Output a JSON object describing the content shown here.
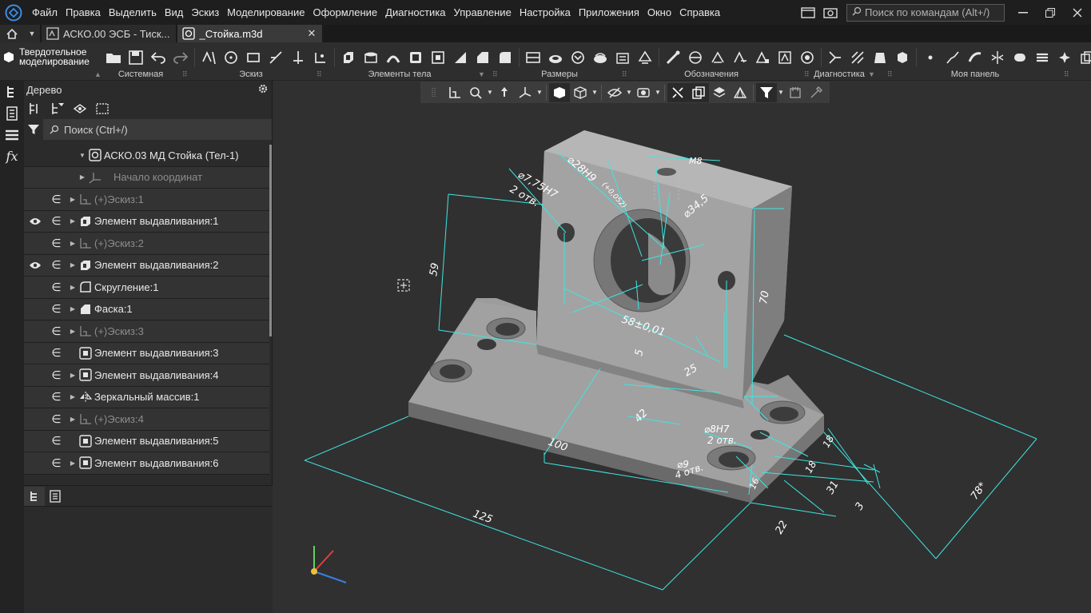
{
  "menu": {
    "items": [
      "Файл",
      "Правка",
      "Выделить",
      "Вид",
      "Эскиз",
      "Моделирование",
      "Оформление",
      "Диагностика",
      "Управление",
      "Настройка",
      "Приложения",
      "Окно",
      "Справка"
    ],
    "command_search_placeholder": "Поиск по командам (Alt+/)"
  },
  "tabs": {
    "items": [
      {
        "label": "АСКО.00 ЭСБ - Тиск..."
      },
      {
        "label": "_Стойка.m3d"
      }
    ],
    "close_glyph": "✕"
  },
  "toolbar": {
    "mode_line1": "Твердотельное",
    "mode_line2": "моделирование",
    "groups": [
      "Системная",
      "Эскиз",
      "Элементы тела",
      "Размеры",
      "Обозначения",
      "Диагностика",
      "Моя панель"
    ]
  },
  "tree": {
    "title": "Дерево",
    "search_placeholder": "Поиск (Ctrl+/)",
    "rows": [
      {
        "label": "АСКО.03 МД Стойка (Тел-1)",
        "icon": "part-icon",
        "dim": false
      },
      {
        "label": "Начало координат",
        "icon": "origin-icon",
        "dim": true
      },
      {
        "label": "(+)Эскиз:1",
        "icon": "sketch-icon",
        "dim": true
      },
      {
        "label": "Элемент выдавливания:1",
        "icon": "extrude-icon",
        "dim": false
      },
      {
        "label": "(+)Эскиз:2",
        "icon": "sketch-icon",
        "dim": true
      },
      {
        "label": "Элемент выдавливания:2",
        "icon": "extrude-icon",
        "dim": false
      },
      {
        "label": "Скругление:1",
        "icon": "fillet-icon",
        "dim": false
      },
      {
        "label": "Фаска:1",
        "icon": "chamfer-icon",
        "dim": false
      },
      {
        "label": "(+)Эскиз:3",
        "icon": "sketch-icon",
        "dim": true
      },
      {
        "label": "Элемент выдавливания:3",
        "icon": "cut-extrude-icon",
        "dim": false
      },
      {
        "label": "Элемент выдавливания:4",
        "icon": "cut-extrude-icon",
        "dim": false
      },
      {
        "label": "Зеркальный массив:1",
        "icon": "mirror-icon",
        "dim": false
      },
      {
        "label": "(+)Эскиз:4",
        "icon": "sketch-icon",
        "dim": true
      },
      {
        "label": "Элемент выдавливания:5",
        "icon": "cut-extrude-icon",
        "dim": false
      },
      {
        "label": "Элемент выдавливания:6",
        "icon": "cut-extrude-icon",
        "dim": false
      }
    ]
  },
  "dimensions": {
    "d_hole": "⌀7,75H7",
    "d_hole_count": "2 отв.",
    "d_bore": "⌀28H9",
    "d_bore_tol": "(+0,052)",
    "thread": "M8",
    "d_counterbore": "⌀34,5",
    "h59": "59",
    "h70": "70",
    "w58": "58±0,01",
    "n5": "5",
    "n25": "25",
    "n42": "42",
    "n100": "100",
    "n125": "125",
    "d8": "⌀8H7",
    "d8_count": "2 отв.",
    "d9": "⌀9",
    "d9_count": "4 отв.",
    "n16": "16",
    "n18a": "18",
    "n18b": "18",
    "n31": "31",
    "n3": "3",
    "n22": "22",
    "n78": "78*"
  },
  "colors": {
    "dimension_line": "#3ee6e0",
    "model_face_light": "#b3b3b3",
    "model_face_mid": "#8e8e8e",
    "model_face_dark": "#6c6c6c",
    "viewport_bg": "#303030",
    "accent_blue": "#2f7fd8"
  }
}
